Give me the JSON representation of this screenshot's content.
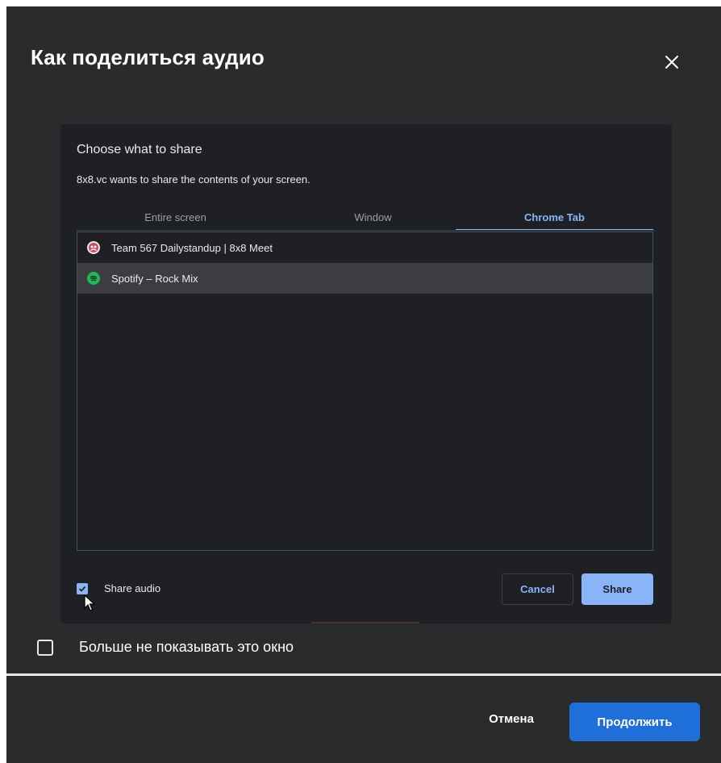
{
  "dialog": {
    "title": "Как поделиться аудио",
    "dont_show_label": "Больше не показывать это окно",
    "cancel_label": "Отмена",
    "continue_label": "Продолжить"
  },
  "picker": {
    "title": "Choose what to share",
    "subtitle": "8x8.vc wants to share the contents of your screen.",
    "tabs": [
      {
        "label": "Entire screen",
        "active": false
      },
      {
        "label": "Window",
        "active": false
      },
      {
        "label": "Chrome Tab",
        "active": true
      }
    ],
    "items": [
      {
        "label": "Team 567 Dailystandup | 8x8 Meet",
        "icon": "8x8-meet-icon",
        "selected": false
      },
      {
        "label": "Spotify – Rock Mix",
        "icon": "spotify-icon",
        "selected": true
      }
    ],
    "share_audio_label": "Share audio",
    "share_audio_checked": true,
    "cancel_label": "Cancel",
    "share_label": "Share"
  },
  "colors": {
    "dialog_bg": "#2a2b2d",
    "accent": "#8ab4f8",
    "primary_button": "#1e6fd9",
    "meet_icon": "#c94a5a",
    "spotify_icon": "#1db954"
  }
}
